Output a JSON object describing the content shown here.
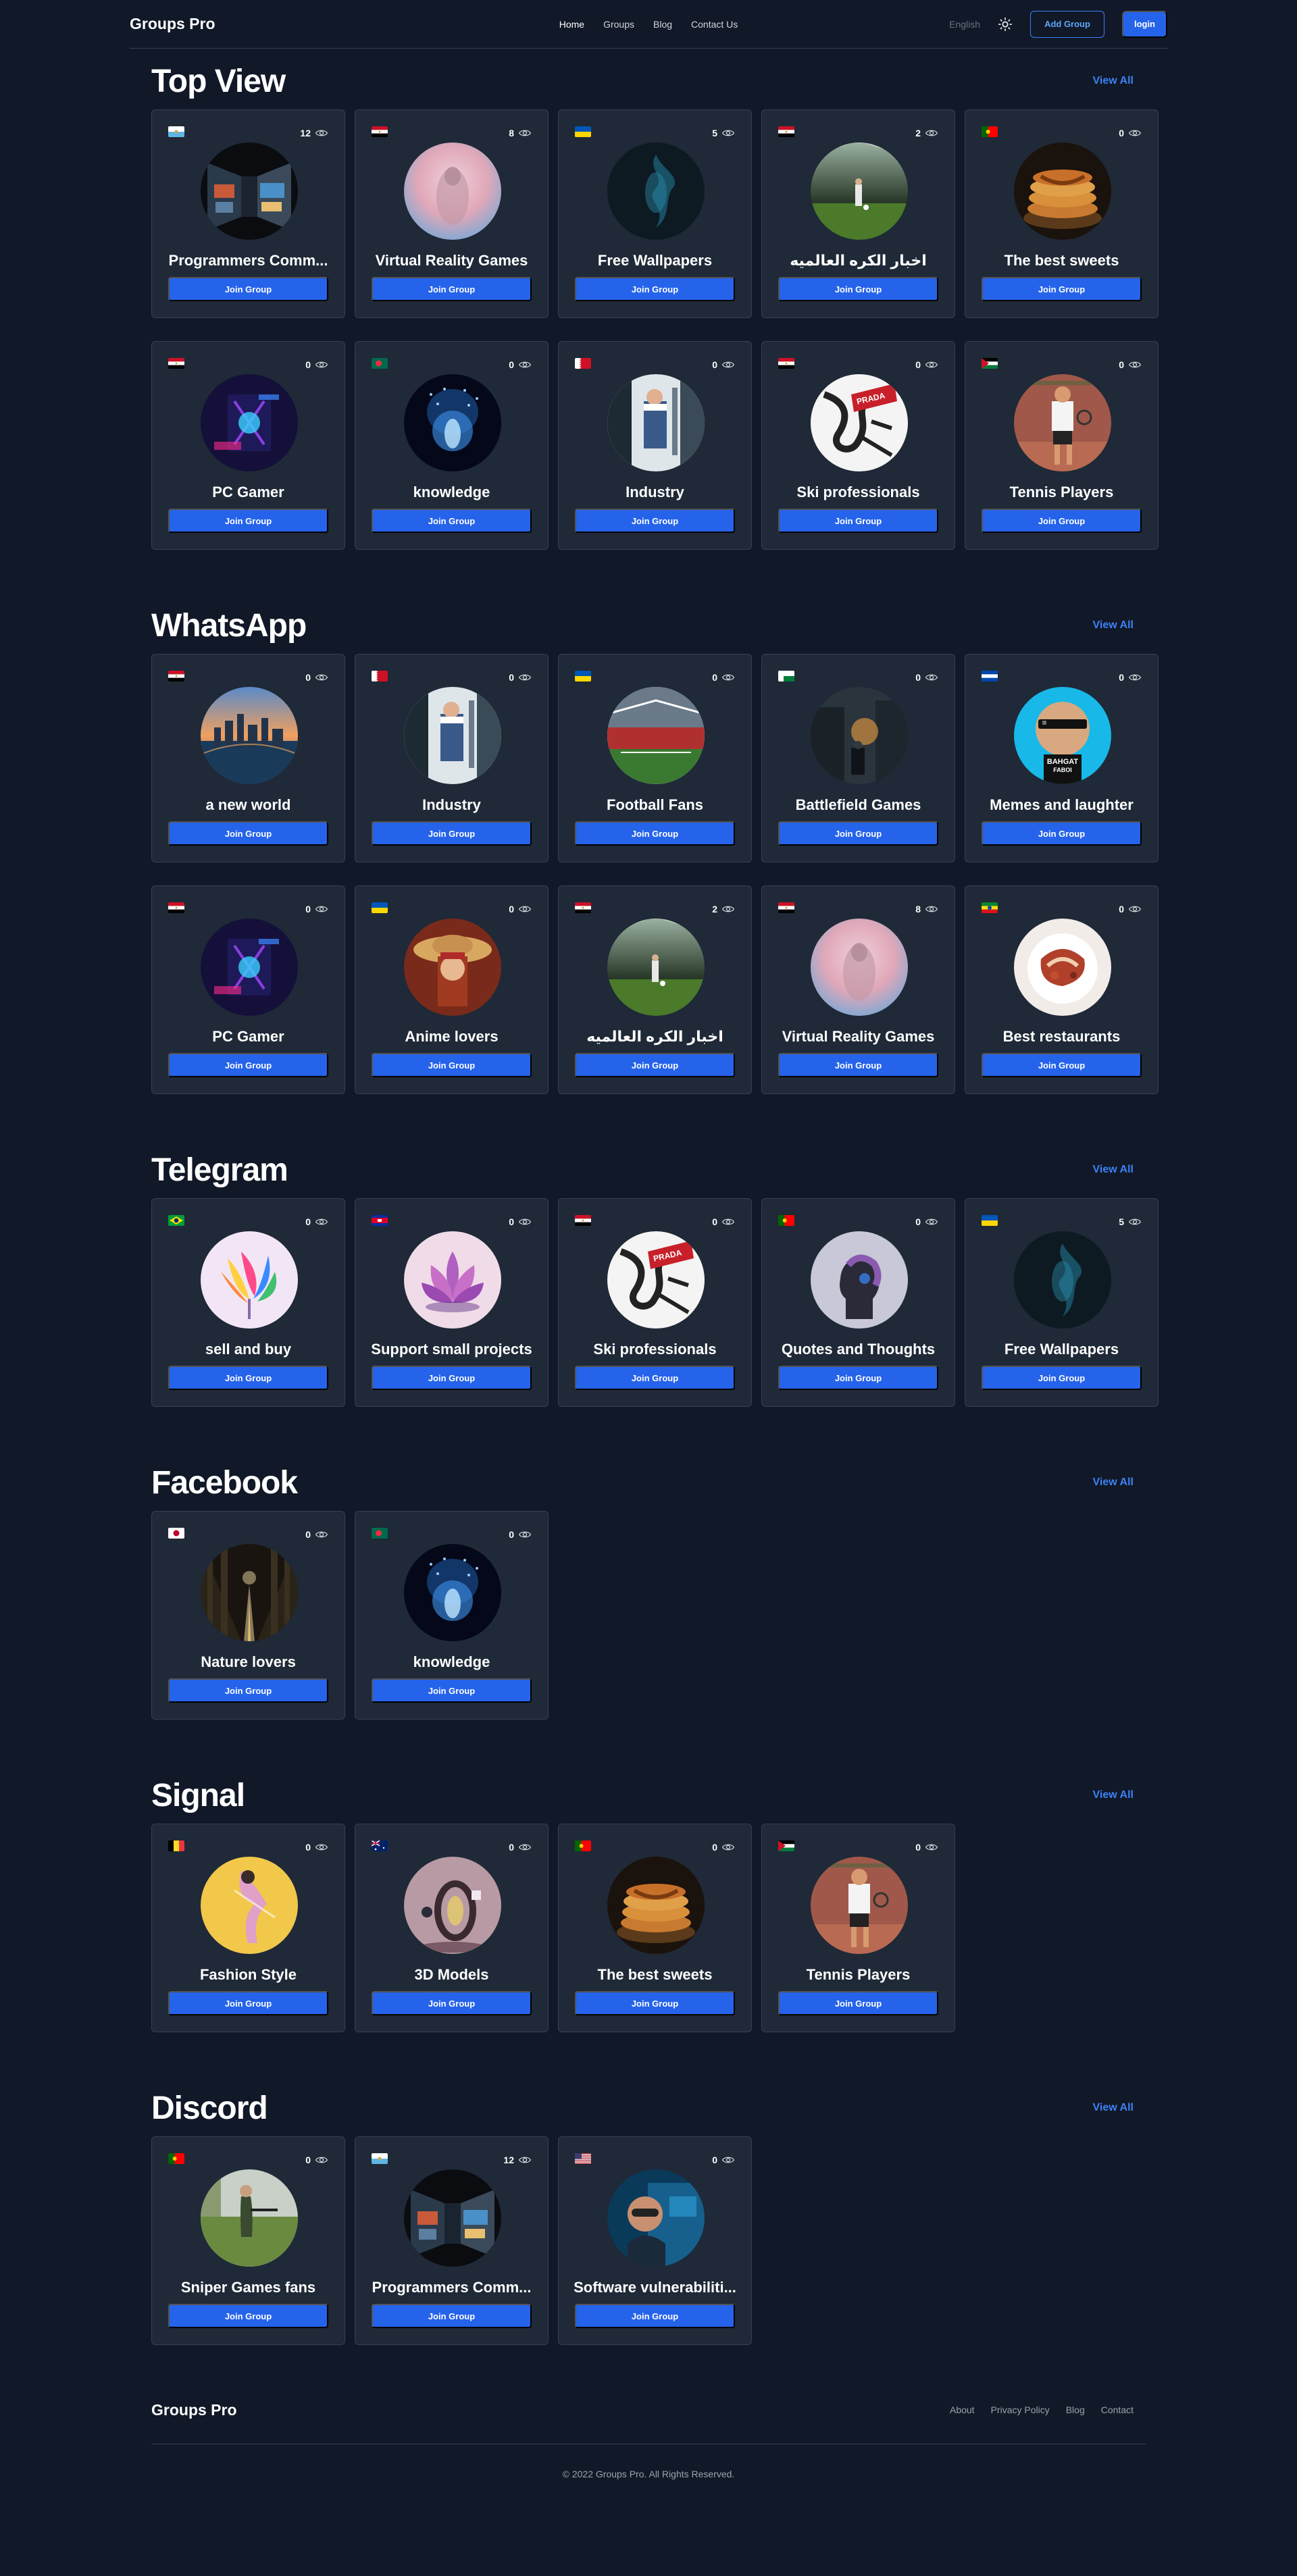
{
  "header": {
    "logo": "Groups Pro",
    "nav": [
      "Home",
      "Groups",
      "Blog",
      "Contact Us"
    ],
    "language": "English",
    "add_group": "Add Group",
    "login": "login"
  },
  "join_label": "Join Group",
  "view_all_label": "View All",
  "sections": [
    {
      "title": "Top View",
      "cards": [
        {
          "title": "Programmers Comm...",
          "views": "12",
          "flag": "sm",
          "img": "prog"
        },
        {
          "title": "Virtual Reality Games",
          "views": "8",
          "flag": "eg",
          "img": "vr"
        },
        {
          "title": "Free Wallpapers",
          "views": "5",
          "flag": "ua",
          "img": "wall"
        },
        {
          "title": "اخبار الكره العالميه",
          "views": "2",
          "flag": "eg",
          "img": "football"
        },
        {
          "title": "The best sweets",
          "views": "0",
          "flag": "pt",
          "img": "sweets"
        },
        {
          "title": "PC Gamer",
          "views": "0",
          "flag": "eg",
          "img": "pc"
        },
        {
          "title": "knowledge",
          "views": "0",
          "flag": "bd",
          "img": "knowledge"
        },
        {
          "title": "Industry",
          "views": "0",
          "flag": "bh",
          "img": "industry"
        },
        {
          "title": "Ski professionals",
          "views": "0",
          "flag": "eg",
          "img": "ski"
        },
        {
          "title": "Tennis Players",
          "views": "0",
          "flag": "jo",
          "img": "tennis"
        }
      ]
    },
    {
      "title": "WhatsApp",
      "cards": [
        {
          "title": "a new world",
          "views": "0",
          "flag": "eg",
          "img": "world"
        },
        {
          "title": "Industry",
          "views": "0",
          "flag": "bh",
          "img": "industry"
        },
        {
          "title": "Football Fans",
          "views": "0",
          "flag": "ua",
          "img": "stadium"
        },
        {
          "title": "Battlefield Games",
          "views": "0",
          "flag": "mg",
          "img": "battle"
        },
        {
          "title": "Memes and laughter",
          "views": "0",
          "flag": "sv",
          "img": "meme"
        },
        {
          "title": "PC Gamer",
          "views": "0",
          "flag": "eg",
          "img": "pc"
        },
        {
          "title": "Anime lovers",
          "views": "0",
          "flag": "ua",
          "img": "anime"
        },
        {
          "title": "اخبار الكره العالميه",
          "views": "2",
          "flag": "eg",
          "img": "football"
        },
        {
          "title": "Virtual Reality Games",
          "views": "8",
          "flag": "eg",
          "img": "vr"
        },
        {
          "title": "Best restaurants",
          "views": "0",
          "flag": "et",
          "img": "food"
        }
      ]
    },
    {
      "title": "Telegram",
      "cards": [
        {
          "title": "sell and buy",
          "views": "0",
          "flag": "br",
          "img": "tulip"
        },
        {
          "title": "Support small projects",
          "views": "0",
          "flag": "kh",
          "img": "lotus"
        },
        {
          "title": "Ski professionals",
          "views": "0",
          "flag": "eg",
          "img": "ski"
        },
        {
          "title": "Quotes and Thoughts",
          "views": "0",
          "flag": "pt",
          "img": "quotes"
        },
        {
          "title": "Free Wallpapers",
          "views": "5",
          "flag": "ua",
          "img": "wall"
        }
      ]
    },
    {
      "title": "Facebook",
      "cards": [
        {
          "title": "Nature lovers",
          "views": "0",
          "flag": "jp",
          "img": "nature"
        },
        {
          "title": "knowledge",
          "views": "0",
          "flag": "bd",
          "img": "knowledge"
        }
      ]
    },
    {
      "title": "Signal",
      "cards": [
        {
          "title": "Fashion Style",
          "views": "0",
          "flag": "be",
          "img": "fashion"
        },
        {
          "title": "3D Models",
          "views": "0",
          "flag": "au",
          "img": "models"
        },
        {
          "title": "The best sweets",
          "views": "0",
          "flag": "pt",
          "img": "sweets"
        },
        {
          "title": "Tennis Players",
          "views": "0",
          "flag": "jo",
          "img": "tennis"
        }
      ]
    },
    {
      "title": "Discord",
      "cards": [
        {
          "title": "Sniper Games fans",
          "views": "0",
          "flag": "pt",
          "img": "sniper"
        },
        {
          "title": "Programmers Comm...",
          "views": "12",
          "flag": "sm",
          "img": "prog"
        },
        {
          "title": "Software vulnerabiliti...",
          "views": "0",
          "flag": "us",
          "img": "software"
        }
      ]
    }
  ],
  "meme_text": "BAHGAT FABOI",
  "ski_text": "PRADA",
  "footer": {
    "logo": "Groups Pro",
    "links": [
      "About",
      "Privacy Policy",
      "Blog",
      "Contact"
    ],
    "copyright": "© 2022 Groups Pro. All Rights Reserved."
  }
}
